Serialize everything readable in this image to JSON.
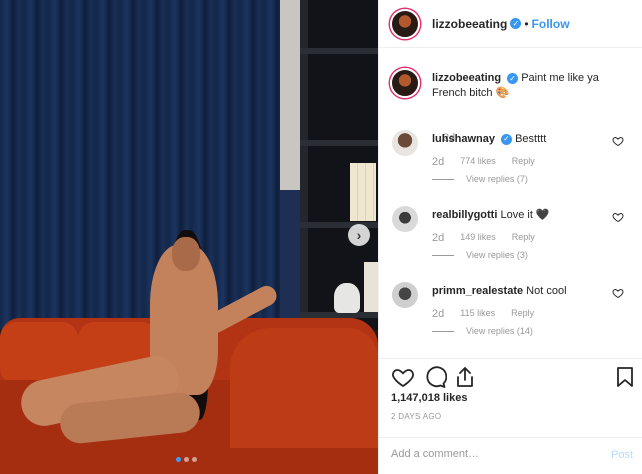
{
  "post": {
    "username": "lizzobeeating",
    "verified_icon": "verified-badge-icon",
    "separator": "•",
    "follow_label": "Follow",
    "caption_text": "Paint me like ya French bitch 🎨",
    "caption_time": "2d",
    "likes": "1,147,018 likes",
    "posted": "2 DAYS AGO",
    "add_comment_placeholder": "Add a comment…",
    "post_label": "Post",
    "carousel": {
      "slide_count": 3,
      "active_index": 0
    }
  },
  "comments": [
    {
      "username": "luhshawnay",
      "verified": true,
      "text": "Bestttt",
      "time": "2d",
      "likes": "774 likes",
      "reply_label": "Reply",
      "view_replies": "View replies (7)"
    },
    {
      "username": "realbillygotti",
      "verified": false,
      "text": "Love it 🖤",
      "time": "2d",
      "likes": "149 likes",
      "reply_label": "Reply",
      "view_replies": "View replies (3)"
    },
    {
      "username": "primm_realestate",
      "verified": false,
      "text": "Not cool",
      "time": "2d",
      "likes": "115 likes",
      "reply_label": "Reply",
      "view_replies": "View replies (14)"
    }
  ],
  "colors": {
    "accent": "#3897f0",
    "muted": "#999999",
    "text": "#262626",
    "border": "#efefef"
  }
}
